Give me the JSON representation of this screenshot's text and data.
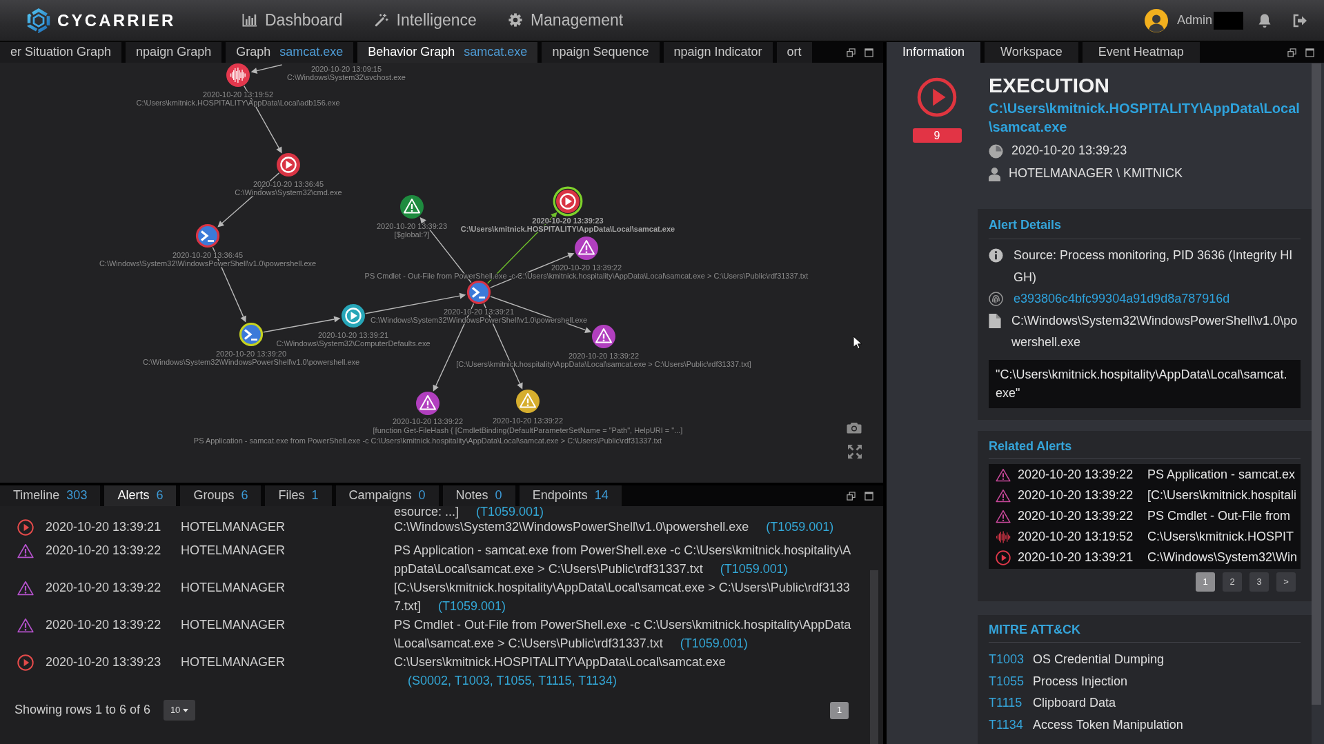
{
  "header": {
    "logo": "CYCARRIER",
    "nav": [
      {
        "label": "Dashboard"
      },
      {
        "label": "Intelligence"
      },
      {
        "label": "Management"
      }
    ],
    "user": "Admin"
  },
  "main_tabs": [
    {
      "label": "er Situation Graph",
      "selected": false
    },
    {
      "label": "npaign Graph",
      "selected": false
    },
    {
      "label": "Graph",
      "file": "samcat.exe",
      "selected": false
    },
    {
      "label": "Behavior Graph",
      "file": "samcat.exe",
      "selected": true
    },
    {
      "label": "npaign Sequence",
      "selected": false
    },
    {
      "label": "npaign Indicator",
      "selected": false
    },
    {
      "label": "ort",
      "selected": false
    }
  ],
  "graph": {
    "nodes": [
      {
        "kind": "offscreen",
        "time": "2020-10-20 13:09:15",
        "label": "C:\\Windows\\System32\\svchost.exe",
        "children": [
          {
            "kind": "waveform",
            "color": "#e3384d",
            "selected": false,
            "edge_highlighted": false,
            "time": "2020-10-20 13:19:52",
            "label": "C:\\Users\\kmitnick.HOSPITALITY\\AppData\\Local\\adb156.exe",
            "children": [
              {
                "kind": "execution",
                "color": "#d93444",
                "selected": false,
                "edge_highlighted": false,
                "time": "2020-10-20 13:36:45",
                "label": "C:\\Windows\\System32\\cmd.exe",
                "children": [
                  {
                    "kind": "powershell",
                    "color": "#d93444",
                    "selected": false,
                    "edge_highlighted": false,
                    "time": "2020-10-20 13:36:45",
                    "label": "C:\\Windows\\System32\\WindowsPowerShell\\v1.0\\powershell.exe",
                    "children": [
                      {
                        "kind": "powershell",
                        "color": "#c6d21f",
                        "selected": false,
                        "edge_highlighted": false,
                        "time": "2020-10-20 13:39:20",
                        "label": "C:\\Windows\\System32\\WindowsPowerShell\\v1.0\\powershell.exe",
                        "children": [
                          {
                            "kind": "execution",
                            "color": "#27a6b8",
                            "selected": false,
                            "edge_highlighted": false,
                            "time": "2020-10-20 13:39:21",
                            "label": "C:\\Windows\\System32\\ComputerDefaults.exe",
                            "children": [
                              {
                                "kind": "powershell",
                                "color": "#d93444",
                                "selected": false,
                                "edge_highlighted": false,
                                "time": "2020-10-20 13:39:21",
                                "label": "C:\\Windows\\System32\\WindowsPowerShell\\v1.0\\powershell.exe",
                                "children": [
                                  {
                                    "kind": "warning",
                                    "color": "#1e8b3f",
                                    "selected": false,
                                    "edge_highlighted": false,
                                    "time": "2020-10-20 13:39:23",
                                    "label": "[$global:?]"
                                  },
                                  {
                                    "kind": "execution",
                                    "color": "#d93444",
                                    "selected": true,
                                    "edge_highlighted": true,
                                    "time": "2020-10-20 13:39:23",
                                    "label": "C:\\Users\\kmitnick.HOSPITALITY\\AppData\\Local\\samcat.exe"
                                  },
                                  {
                                    "kind": "warning",
                                    "color": "#b13fbf",
                                    "selected": false,
                                    "edge_highlighted": false,
                                    "time": "2020-10-20 13:39:22",
                                    "label": "PS Cmdlet - Out-File from PowerShell.exe -c C:\\Users\\kmitnick.hospitality\\AppData\\Local\\samcat.exe > C:\\Users\\Public\\rdf31337.txt"
                                  },
                                  {
                                    "kind": "warning",
                                    "color": "#b13fbf",
                                    "selected": false,
                                    "edge_highlighted": false,
                                    "time": "2020-10-20 13:39:22",
                                    "label": "[C:\\Users\\kmitnick.hospitality\\AppData\\Local\\samcat.exe > C:\\Users\\Public\\rdf31337.txt]"
                                  },
                                  {
                                    "kind": "warning",
                                    "color": "#b13fbf",
                                    "selected": false,
                                    "edge_highlighted": false,
                                    "time": "2020-10-20 13:39:22",
                                    "label": "PS Application - samcat.exe from PowerShell.exe -c C:\\Users\\kmitnick.hospitality\\AppData\\Local\\samcat.exe > C:\\Users\\Public\\rdf31337.txt"
                                  },
                                  {
                                    "kind": "warning",
                                    "color": "#d6ae2e",
                                    "selected": false,
                                    "edge_highlighted": false,
                                    "time": "2020-10-20 13:39:22",
                                    "label": "[function Get-FileHash { [CmdletBinding(DefaultParameterSetName = \"Path\", HelpURI = \"...]"
                                  }
                                ]
                              }
                            ]
                          }
                        ]
                      }
                    ]
                  }
                ]
              }
            ]
          }
        ]
      }
    ]
  },
  "bottom_tabs": [
    {
      "label": "Timeline",
      "count": "303",
      "selected": false
    },
    {
      "label": "Alerts",
      "count": "6",
      "selected": true
    },
    {
      "label": "Groups",
      "count": "6",
      "selected": false
    },
    {
      "label": "Files",
      "count": "1",
      "selected": false
    },
    {
      "label": "Campaigns",
      "count": "0",
      "selected": false
    },
    {
      "label": "Notes",
      "count": "0",
      "selected": false
    },
    {
      "label": "Endpoints",
      "count": "14",
      "selected": false
    }
  ],
  "alerts_table": {
    "rows": [
      {
        "kind": "cut_off",
        "description": "esource: ...]",
        "technique": "(T1059.001)"
      },
      {
        "kind": "execution",
        "time": "2020-10-20 13:39:21",
        "host": "HOTELMANAGER",
        "description": "C:\\Windows\\System32\\WindowsPowerShell\\v1.0\\powershell.exe",
        "technique": "(T1059.001)"
      },
      {
        "kind": "alert",
        "time": "2020-10-20 13:39:22",
        "host": "HOTELMANAGER",
        "description": "PS Application - samcat.exe from PowerShell.exe -c C:\\Users\\kmitnick.hospitality\\AppData\\Local\\samcat.exe > C:\\Users\\Public\\rdf31337.txt",
        "technique": "(T1059.001)"
      },
      {
        "kind": "alert",
        "time": "2020-10-20 13:39:22",
        "host": "HOTELMANAGER",
        "description": "[C:\\Users\\kmitnick.hospitality\\AppData\\Local\\samcat.exe > C:\\Users\\Public\\rdf31337.txt]",
        "technique": "(T1059.001)"
      },
      {
        "kind": "alert",
        "time": "2020-10-20 13:39:22",
        "host": "HOTELMANAGER",
        "description": "PS Cmdlet - Out-File from PowerShell.exe -c C:\\Users\\kmitnick.hospitality\\AppData\\Local\\samcat.exe > C:\\Users\\Public\\rdf31337.txt",
        "technique": "(T1059.001)"
      },
      {
        "kind": "execution",
        "time": "2020-10-20 13:39:23",
        "host": "HOTELMANAGER",
        "description": "C:\\Users\\kmitnick.HOSPITALITY\\AppData\\Local\\samcat.exe",
        "technique": "(S0002, T1003, T1055, T1115, T1134)"
      }
    ],
    "summary": "Showing rows 1 to 6 of 6",
    "page_size": "10",
    "pages": [
      {
        "label": "1",
        "selected": true
      }
    ]
  },
  "info_tabs": [
    {
      "label": "Information",
      "selected": true
    },
    {
      "label": "Workspace",
      "selected": false
    },
    {
      "label": "Event Heatmap",
      "selected": false
    }
  ],
  "event": {
    "kind": "execution",
    "count": "9",
    "title": "EXECUTION",
    "path": "C:\\Users\\kmitnick.HOSPITALITY\\AppData\\Local\\samcat.exe",
    "time": "2020-10-20 13:39:23",
    "user": "HOTELMANAGER \\ KMITNICK"
  },
  "alert_details": {
    "title": "Alert Details",
    "source": "Source: Process monitoring, PID 3636 (Integrity HIGH)",
    "hash": "e393806c4bfc99304a91d9d8a787916d",
    "file": "C:\\Windows\\System32\\WindowsPowerShell\\v1.0\\powershell.exe",
    "command": "\"C:\\Users\\kmitnick.hospitality\\AppData\\Local\\samcat.exe\""
  },
  "related_alerts": {
    "title": "Related Alerts",
    "rows": [
      {
        "kind": "alert",
        "time": "2020-10-20 13:39:22",
        "text": "PS Application - samcat.ex"
      },
      {
        "kind": "alert",
        "time": "2020-10-20 13:39:22",
        "text": "[C:\\Users\\kmitnick.hospitali"
      },
      {
        "kind": "alert",
        "time": "2020-10-20 13:39:22",
        "text": "PS Cmdlet - Out-File from"
      },
      {
        "kind": "waveform",
        "time": "2020-10-20 13:19:52",
        "text": "C:\\Users\\kmitnick.HOSPIT"
      },
      {
        "kind": "execution",
        "time": "2020-10-20 13:39:21",
        "text": "C:\\Windows\\System32\\Win"
      }
    ],
    "pages": [
      {
        "label": "1",
        "selected": true
      },
      {
        "label": "2",
        "selected": false
      },
      {
        "label": "3",
        "selected": false
      },
      {
        "label": ">",
        "selected": false
      }
    ]
  },
  "mitre": {
    "title": "MITRE ATT&CK",
    "techniques": [
      {
        "id": "T1003",
        "name": "OS Credential Dumping"
      },
      {
        "id": "T1055",
        "name": "Process Injection"
      },
      {
        "id": "T1115",
        "name": "Clipboard Data"
      },
      {
        "id": "T1134",
        "name": "Access Token Manipulation"
      }
    ]
  }
}
